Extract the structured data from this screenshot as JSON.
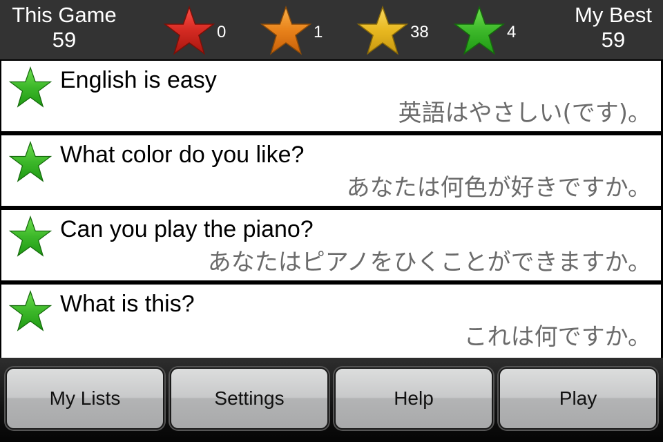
{
  "header": {
    "this_game_label": "This Game",
    "this_game_value": "59",
    "my_best_label": "My Best",
    "my_best_value": "59",
    "star_counts": [
      {
        "icon": "red-star-icon",
        "color": "#d42a22",
        "count": "0"
      },
      {
        "icon": "orange-star-icon",
        "color": "#e8821a",
        "count": "1"
      },
      {
        "icon": "yellow-star-icon",
        "color": "#e8b820",
        "count": "38"
      },
      {
        "icon": "green-star-icon",
        "color": "#3db82a",
        "count": "4"
      }
    ]
  },
  "phrases": [
    {
      "icon": "green-star-icon",
      "english": "English is easy",
      "japanese": "英語はやさしい(です)。"
    },
    {
      "icon": "green-star-icon",
      "english": "What color do you like?",
      "japanese": "あなたは何色が好きですか。"
    },
    {
      "icon": "green-star-icon",
      "english": "Can you play the piano?",
      "japanese": "あなたはピアノをひくことができますか。"
    },
    {
      "icon": "green-star-icon",
      "english": "What is this?",
      "japanese": "これは何ですか。"
    }
  ],
  "toolbar": {
    "my_lists_label": "My Lists",
    "settings_label": "Settings",
    "help_label": "Help",
    "play_label": "Play"
  }
}
